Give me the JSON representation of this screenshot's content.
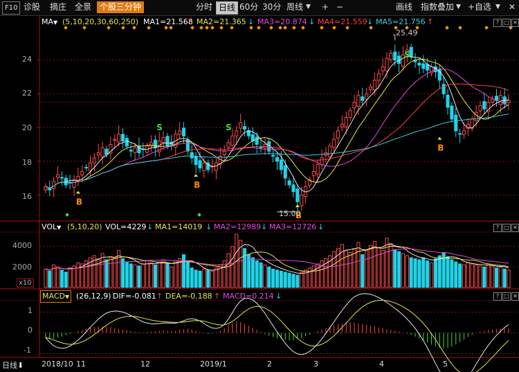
{
  "topbar": {
    "f10": "F10",
    "diagnose": "诊股",
    "picks": "摘庄",
    "fullview": "全景",
    "intraday_tab": "个股三分钟",
    "periods": [
      "分时",
      "日线",
      "60分",
      "30分",
      "周线"
    ],
    "active_period": "日线",
    "plus": "+",
    "minus": "−",
    "drawline": "画线",
    "overlay": "指数叠加",
    "add_fav": "+自选",
    "close": "✕"
  },
  "price_panel": {
    "ma_button": "MA",
    "params": "(5,10,20,30,60,250)",
    "ma1": "MA1=21.568",
    "ma2": "MA2=21.365",
    "ma3": "MA3=20.874",
    "ma4": "MA4=21.559",
    "ma5": "MA5=21.756",
    "high_label": "25.49",
    "low_label": "15.00",
    "y_ticks": [
      "24",
      "22",
      "20",
      "18",
      "16"
    ],
    "buy_signal": "B",
    "sell_signal": "S"
  },
  "vol_panel": {
    "vol_button": "VOL",
    "params": "(5,10,20)",
    "vol": "VOL=4229",
    "ma1": "MA1=14019",
    "ma2": "MA2=12989",
    "ma3": "MA3=12726",
    "y_ticks": [
      "4000",
      "2000"
    ],
    "unit": "x10"
  },
  "macd_panel": {
    "macd_button": "MACD",
    "params": "(26,12,9)",
    "dif": "DIF=-0.081",
    "dea": "DEA=-0.188",
    "macd": "MACD=0.214",
    "y_ticks": [
      "1",
      "0",
      "-1"
    ]
  },
  "xaxis": {
    "period_label": "日线",
    "labels": [
      "2018/10",
      "11",
      "12",
      "2019/1",
      "2",
      "3",
      "4",
      "5"
    ]
  },
  "panel_tools": [
    "?",
    "□",
    "✕"
  ],
  "colors": {
    "up": "#ff4a4a",
    "down": "#1fd3e8",
    "ma1": "#e6e6e6",
    "ma2": "#e8e84a",
    "ma3": "#e04ae0",
    "ma4": "#ff4040",
    "ma5": "#3ad0e0",
    "grid": "#7a1a1a",
    "axis": "#b01010",
    "signal_arrow": "#e8e84a"
  },
  "chart_data": {
    "type": "candlestick",
    "high": 25.49,
    "low": 15.0,
    "y_range": [
      14.5,
      26.0
    ],
    "close_series": [
      16.5,
      16.3,
      16.8,
      17.2,
      17.0,
      16.6,
      16.7,
      16.9,
      17.1,
      17.4,
      17.6,
      17.9,
      18.2,
      18.5,
      18.8,
      18.4,
      19.0,
      19.3,
      19.6,
      19.2,
      18.9,
      18.6,
      18.8,
      18.5,
      18.7,
      18.9,
      19.1,
      18.8,
      19.2,
      19.4,
      18.9,
      19.0,
      19.6,
      19.8,
      19.5,
      18.6,
      18.2,
      17.8,
      17.6,
      17.9,
      17.5,
      17.7,
      17.9,
      18.3,
      18.6,
      19.1,
      19.5,
      19.8,
      20.3,
      19.9,
      19.5,
      19.2,
      19.0,
      18.8,
      19.0,
      18.6,
      18.3,
      18.0,
      17.5,
      17.0,
      16.6,
      16.2,
      15.6,
      16.0,
      16.5,
      16.9,
      17.4,
      17.8,
      18.2,
      18.5,
      18.9,
      19.3,
      19.8,
      20.2,
      20.6,
      21.0,
      21.5,
      21.9,
      21.6,
      22.0,
      22.4,
      22.8,
      23.2,
      23.6,
      24.1,
      24.4,
      24.0,
      23.8,
      24.3,
      24.6,
      24.2,
      23.9,
      23.7,
      23.5,
      23.4,
      23.6,
      23.3,
      22.8,
      22.0,
      21.2,
      20.5,
      19.8,
      19.6,
      19.8,
      20.2,
      20.5,
      20.9,
      21.3,
      21.1,
      21.5,
      21.7,
      21.6,
      21.9,
      21.4,
      21.6
    ],
    "volume_series": [
      1800,
      1600,
      2200,
      2000,
      1700,
      1500,
      1900,
      2100,
      2400,
      2300,
      2600,
      2900,
      3100,
      2800,
      3300,
      2700,
      3000,
      2900,
      3600,
      2800,
      2500,
      2300,
      2200,
      2100,
      2300,
      2600,
      2400,
      2200,
      2500,
      2700,
      2300,
      2000,
      2600,
      2800,
      3200,
      2500,
      1900,
      1700,
      1600,
      1800,
      1700,
      1600,
      1900,
      2200,
      2600,
      3300,
      4000,
      5200,
      4600,
      3800,
      3200,
      2900,
      2600,
      2400,
      2200,
      2000,
      1800,
      1700,
      1600,
      1500,
      1400,
      1300,
      1200,
      1500,
      1700,
      1900,
      2100,
      2300,
      2600,
      2800,
      3100,
      3500,
      3800,
      4200,
      3600,
      3400,
      3800,
      4400,
      3200,
      3600,
      4100,
      4500,
      3900,
      3600,
      4800,
      4300,
      3700,
      3500,
      3300,
      3100,
      2900,
      2800,
      2700,
      2900,
      2600,
      2400,
      2800,
      3100,
      3400,
      3000,
      2700,
      2500,
      2300,
      2200,
      2400,
      2300,
      2200,
      2100,
      2000,
      2300,
      2100,
      1900,
      2000,
      1800,
      1700
    ],
    "macd_hist": [
      -0.25,
      -0.3,
      -0.28,
      -0.22,
      -0.18,
      -0.12,
      -0.05,
      0.02,
      0.08,
      0.14,
      0.2,
      0.25,
      0.28,
      0.3,
      0.32,
      0.3,
      0.27,
      0.24,
      0.2,
      0.16,
      0.12,
      0.08,
      0.05,
      0.03,
      0.02,
      0.04,
      0.06,
      0.08,
      0.1,
      0.12,
      0.1,
      0.08,
      0.1,
      0.14,
      0.18,
      0.2,
      0.16,
      0.1,
      0.04,
      -0.02,
      -0.05,
      -0.03,
      0.02,
      0.1,
      0.22,
      0.36,
      0.48,
      0.56,
      0.52,
      0.44,
      0.34,
      0.24,
      0.14,
      0.04,
      -0.06,
      -0.14,
      -0.2,
      -0.26,
      -0.3,
      -0.34,
      -0.36,
      -0.34,
      -0.3,
      -0.24,
      -0.16,
      -0.08,
      0.0,
      0.08,
      0.16,
      0.24,
      0.3,
      0.36,
      0.42,
      0.46,
      0.5,
      0.52,
      0.5,
      0.46,
      0.42,
      0.38,
      0.34,
      0.3,
      0.26,
      0.22,
      0.18,
      0.14,
      0.1,
      0.06,
      0.02,
      -0.04,
      -0.1,
      -0.18,
      -0.26,
      -0.36,
      -0.46,
      -0.56,
      -0.64,
      -0.7,
      -0.74,
      -0.72,
      -0.66,
      -0.56,
      -0.44,
      -0.32,
      -0.2,
      -0.1,
      0.0,
      0.06,
      0.1,
      0.14,
      0.16,
      0.18,
      0.2,
      0.21,
      0.21
    ]
  }
}
